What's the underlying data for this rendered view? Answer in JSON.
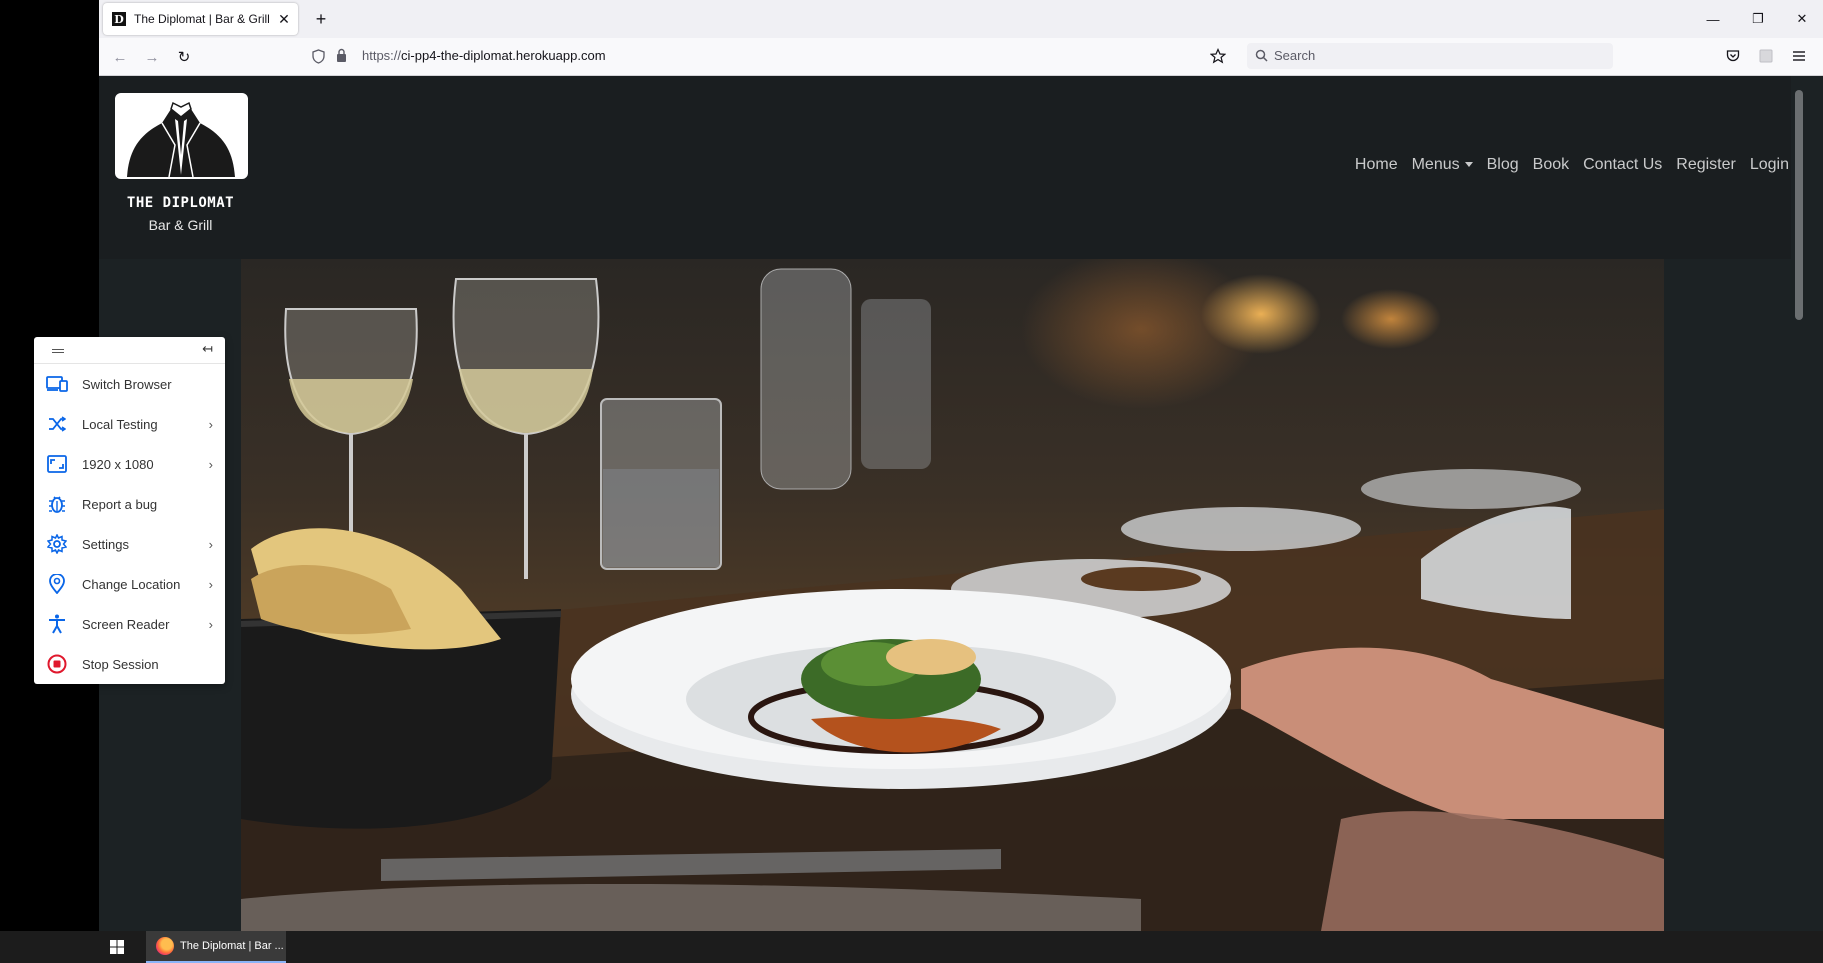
{
  "browser": {
    "tab": {
      "favicon": "D",
      "title": "The Diplomat | Bar & Grill",
      "close": "✕"
    },
    "new_tab": "+",
    "window_controls": {
      "minimize": "—",
      "restore": "❐",
      "close": "✕"
    },
    "nav": {
      "back": "←",
      "forward": "→",
      "reload": "↻"
    },
    "url_prefix": "https://",
    "url_host": "ci-pp4-the-diplomat.herokuapp.com",
    "search_placeholder": "Search"
  },
  "site": {
    "logo_name": "THE DIPLOMAT",
    "logo_sub": "Bar & Grill",
    "nav": {
      "home": "Home",
      "menus": "Menus",
      "blog": "Blog",
      "book": "Book",
      "contact": "Contact Us",
      "register": "Register",
      "login": "Login"
    }
  },
  "bs_panel": {
    "items": [
      {
        "label": "Switch Browser",
        "icon": "devices-icon",
        "has_arrow": false
      },
      {
        "label": "Local Testing",
        "icon": "shuffle-icon",
        "has_arrow": true
      },
      {
        "label": "1920 x 1080",
        "icon": "resolution-icon",
        "has_arrow": true
      },
      {
        "label": "Report a bug",
        "icon": "bug-icon",
        "has_arrow": false
      },
      {
        "label": "Settings",
        "icon": "gear-icon",
        "has_arrow": true
      },
      {
        "label": "Change Location",
        "icon": "location-pin-icon",
        "has_arrow": true
      },
      {
        "label": "Screen Reader",
        "icon": "accessibility-icon",
        "has_arrow": true
      },
      {
        "label": "Stop Session",
        "icon": "stop-icon",
        "has_arrow": false
      }
    ],
    "arrow": "›",
    "collapse": "↤"
  },
  "taskbar": {
    "item_label": "The Diplomat | Bar ..."
  },
  "colors": {
    "accent_blue": "#0a66e8",
    "stop_red": "#e0182d",
    "page_bg": "#1c2224"
  }
}
